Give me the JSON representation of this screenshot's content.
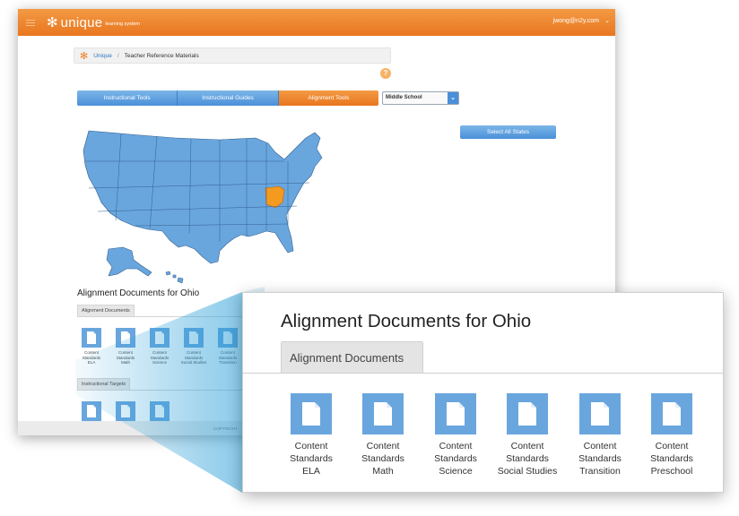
{
  "header": {
    "brand_name": "unique",
    "brand_tagline": "learning system",
    "user": "jwong@n2y.com"
  },
  "breadcrumb": {
    "home": "Unique",
    "separator": "/",
    "current": "Teacher Reference Materials"
  },
  "help_label": "?",
  "tabs": [
    {
      "label": "Instructional Tools",
      "active": false
    },
    {
      "label": "Instructional Guides",
      "active": false
    },
    {
      "label": "Alignment Tools",
      "active": true
    }
  ],
  "grade_select": {
    "value": "Middle School"
  },
  "select_all_label": "Select All States",
  "map": {
    "selected_state": "Ohio"
  },
  "section": {
    "title": "Alignment Documents for Ohio",
    "documents_tab": "Alignment Documents",
    "targets_tab": "Instructional Targets",
    "documents": [
      {
        "label": "Content Standards ELA",
        "l1": "Content",
        "l2": "Standards",
        "l3": "ELA"
      },
      {
        "label": "Content Standards Math",
        "l1": "Content",
        "l2": "Standards",
        "l3": "Math"
      },
      {
        "label": "Content Standards Science",
        "l1": "Content",
        "l2": "Standards",
        "l3": "Science"
      },
      {
        "label": "Content Standards Social Studies",
        "l1": "Content",
        "l2": "Standards",
        "l3": "Social Studies"
      },
      {
        "label": "Content Standards Transition",
        "l1": "Content",
        "l2": "Standards",
        "l3": "Transition"
      },
      {
        "label": "Content Standards Preschool",
        "l1": "Content",
        "l2": "Standards",
        "l3": "Preschool"
      }
    ]
  },
  "footer": {
    "copyright": "COPYRIGHT"
  },
  "colors": {
    "brand_orange": "#ef7d22",
    "tab_blue": "#4a90d9",
    "map_blue": "#6aa6de",
    "highlight": "#f39a1f"
  },
  "icons": {
    "brand": "snowflake-logo-icon",
    "document": "document-icon",
    "menu": "hamburger-icon",
    "dropdown": "chevron-down-icon"
  }
}
